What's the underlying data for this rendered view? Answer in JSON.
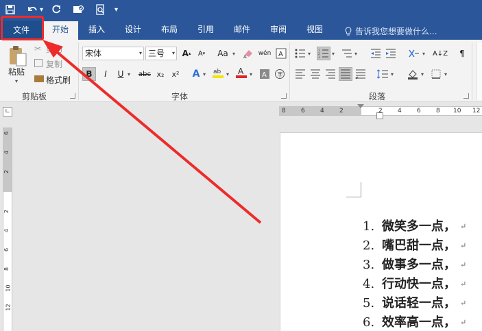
{
  "quick_access": {
    "items": [
      "save-icon",
      "undo-icon",
      "redo-icon",
      "touch-mode-icon",
      "print-preview-icon"
    ],
    "more": "▾"
  },
  "tabs": [
    {
      "label": "文件"
    },
    {
      "label": "开始"
    },
    {
      "label": "插入"
    },
    {
      "label": "设计"
    },
    {
      "label": "布局"
    },
    {
      "label": "引用"
    },
    {
      "label": "邮件"
    },
    {
      "label": "审阅"
    },
    {
      "label": "视图"
    }
  ],
  "tell_me": {
    "placeholder": "告诉我您想要做什么..."
  },
  "clipboard": {
    "paste": "粘贴",
    "cut": "剪切",
    "copy": "复制",
    "format_painter": "格式刷",
    "group_label": "剪贴板"
  },
  "font": {
    "family": "宋体",
    "size": "三号",
    "group_label": "字体",
    "grow": "A",
    "shrink": "A",
    "case": "Aa",
    "bold": "B",
    "italic": "I",
    "underline": "U",
    "strike": "abc",
    "subscript": "x₂",
    "superscript": "x²"
  },
  "paragraph": {
    "group_label": "段落"
  },
  "ruler": {
    "h_numbers": [
      "8",
      "6",
      "4",
      "2",
      "",
      "2",
      "4",
      "6",
      "8",
      "10",
      "12"
    ],
    "v_numbers": [
      "6",
      "4",
      "2",
      "",
      "2",
      "4",
      "6",
      "8",
      "10",
      "12"
    ]
  },
  "document": {
    "list": [
      {
        "num": "1.",
        "text": "微笑多一点，",
        "mark": "↵"
      },
      {
        "num": "2.",
        "text": "嘴巴甜一点，",
        "mark": "↵"
      },
      {
        "num": "3.",
        "text": "做事多一点，",
        "mark": "↵"
      },
      {
        "num": "4.",
        "text": "行动快一点，",
        "mark": "↵"
      },
      {
        "num": "5.",
        "text": "说话轻一点，",
        "mark": "↵"
      },
      {
        "num": "6.",
        "text": "效率高一点，",
        "mark": "↵"
      }
    ]
  },
  "colors": {
    "title_bar": "#2b579a",
    "highlight_red": "#ee2b2b",
    "font_color_red": "#e02424",
    "highlight_yellow": "#f5e400"
  }
}
